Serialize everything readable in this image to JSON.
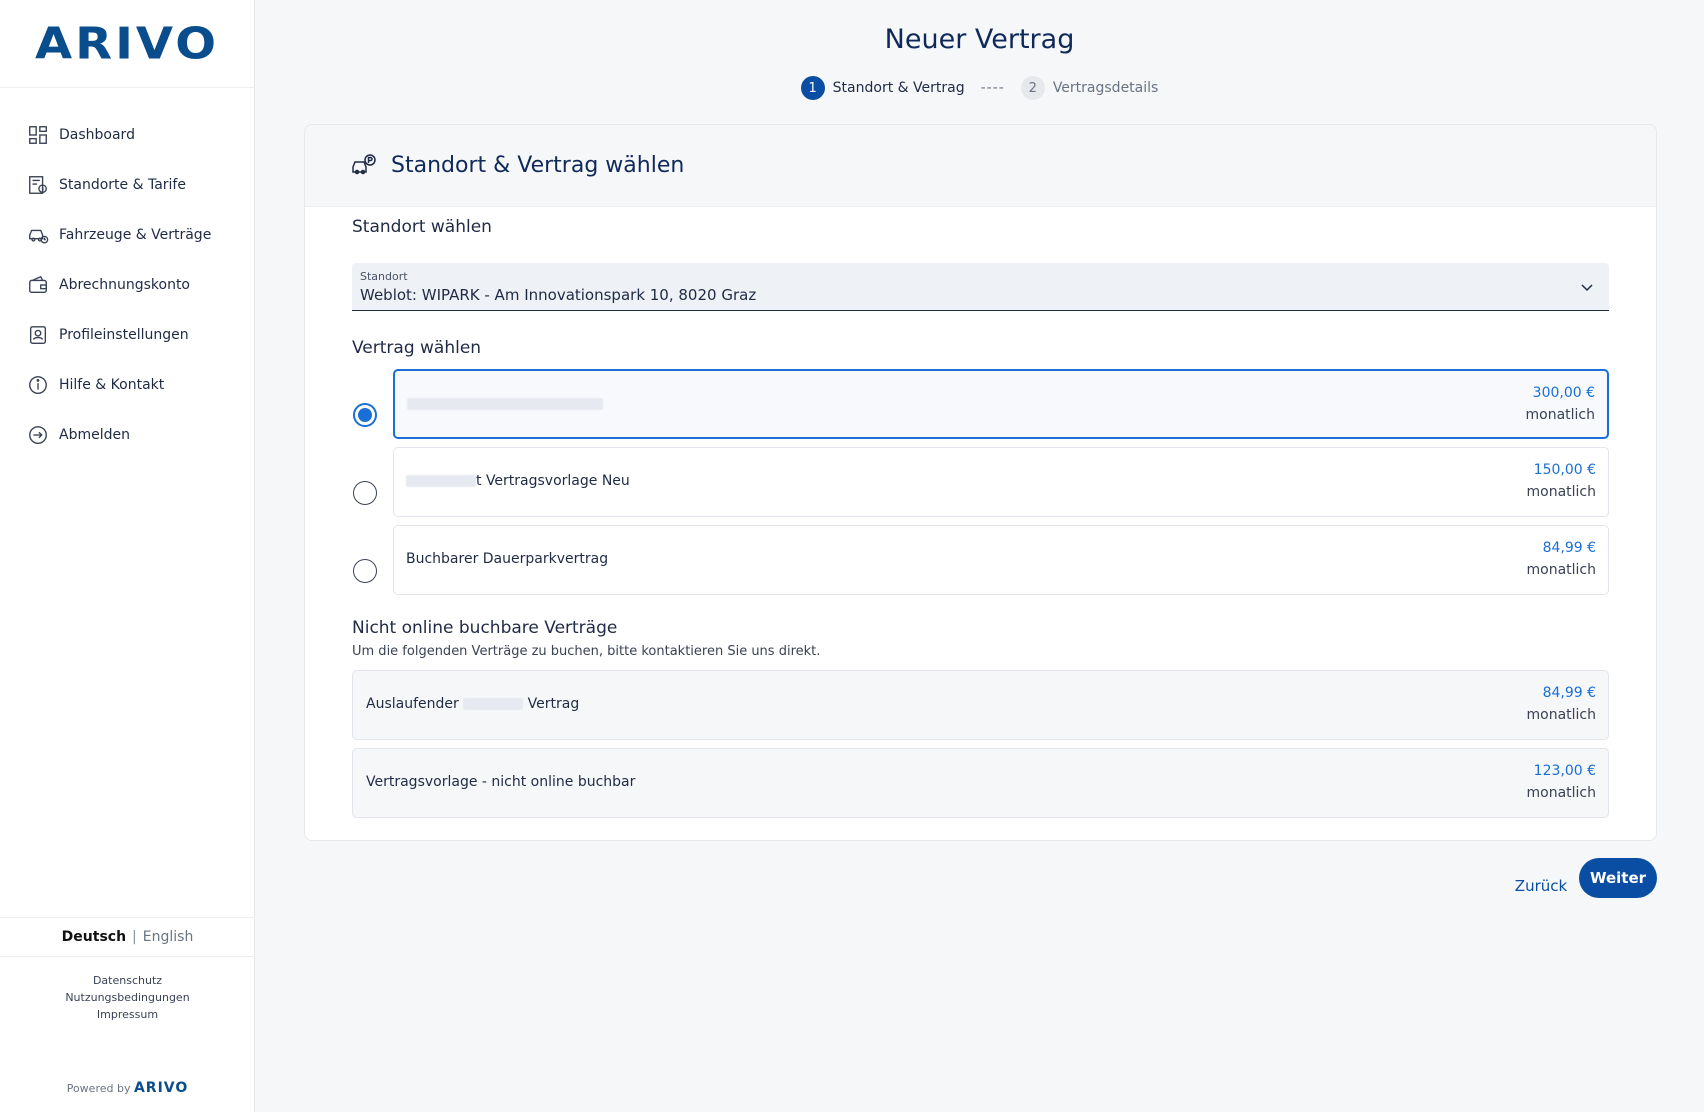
{
  "brand": {
    "logo": "ARIVO",
    "powered_prefix": "Powered by",
    "powered_brand": "ARIVO"
  },
  "sidebar": {
    "items": [
      {
        "label": "Dashboard",
        "icon": "dashboard-icon"
      },
      {
        "label": "Standorte & Tarife",
        "icon": "locations-icon"
      },
      {
        "label": "Fahrzeuge & Verträge",
        "icon": "car-contract-icon"
      },
      {
        "label": "Abrechnungskonto",
        "icon": "wallet-icon"
      },
      {
        "label": "Profileinstellungen",
        "icon": "profile-icon"
      },
      {
        "label": "Hilfe & Kontakt",
        "icon": "info-icon"
      },
      {
        "label": "Abmelden",
        "icon": "logout-icon"
      }
    ],
    "languages": {
      "active": "Deutsch",
      "separator": "|",
      "inactive": "English"
    },
    "legal": [
      "Datenschutz",
      "Nutzungsbedingungen",
      "Impressum"
    ]
  },
  "header": {
    "title": "Neuer Vertrag",
    "steps": [
      {
        "num": "1",
        "label": "Standort & Vertrag",
        "active": true
      },
      {
        "num": "2",
        "label": "Vertragsdetails",
        "active": false
      }
    ],
    "step_divider": "----"
  },
  "card": {
    "title": "Standort & Vertrag wählen",
    "location_section": "Standort wählen",
    "location_field": {
      "label": "Standort",
      "value": "Weblot: WIPARK - Am Innovationspark 10, 8020 Graz"
    },
    "contract_section": "Vertrag wählen",
    "contracts": [
      {
        "name": "",
        "price": "300,00 €",
        "period": "monatlich",
        "selected": true
      },
      {
        "name": "t Vertragsvorlage Neu",
        "price": "150,00 €",
        "period": "monatlich",
        "selected": false
      },
      {
        "name": "Buchbarer Dauerparkvertrag",
        "price": "84,99 €",
        "period": "monatlich",
        "selected": false
      }
    ],
    "not_bookable_section": "Nicht online buchbare Verträge",
    "not_bookable_note": "Um die folgenden Verträge zu buchen, bitte kontaktieren Sie uns direkt.",
    "not_bookable": [
      {
        "name_start": "Auslaufender",
        "name_end": "Vertrag",
        "price": "84,99 €",
        "period": "monatlich"
      },
      {
        "name": "Vertragsvorlage - nicht online buchbar",
        "price": "123,00 €",
        "period": "monatlich"
      }
    ]
  },
  "actions": {
    "back": "Zurück",
    "next": "Weiter"
  },
  "colors": {
    "primary": "#0a4ea3",
    "accent": "#1a6fd6",
    "brand": "#0a4d8c"
  }
}
